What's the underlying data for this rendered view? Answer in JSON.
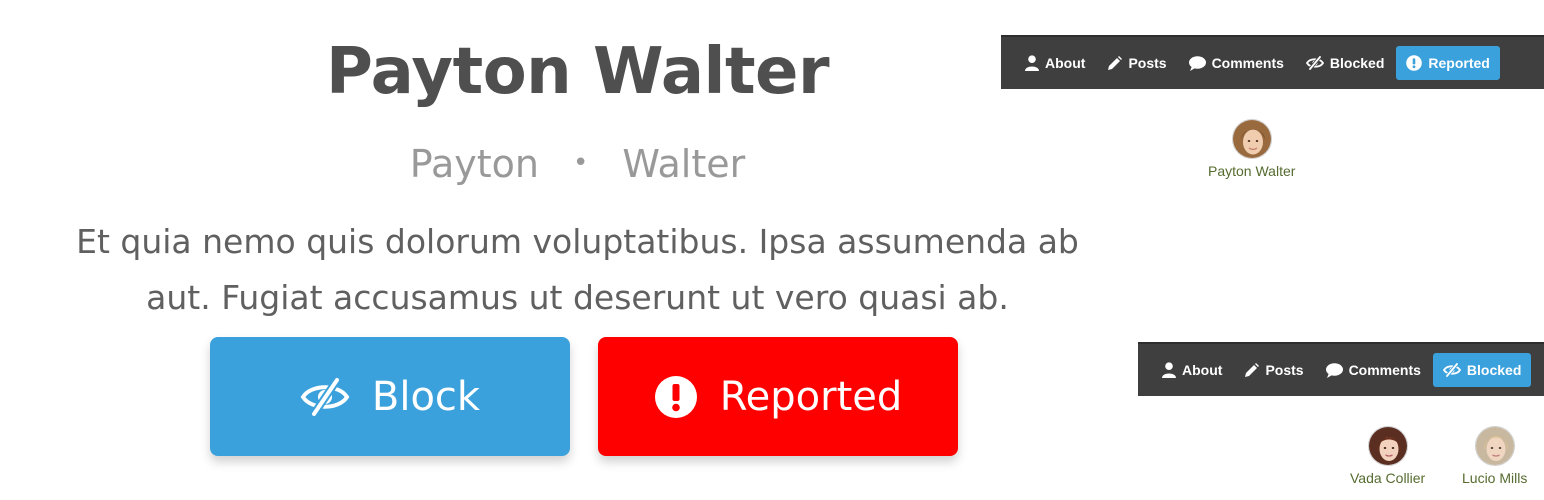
{
  "profile": {
    "full_name": "Payton Walter",
    "first_name": "Payton",
    "separator": "•",
    "last_name": "Walter",
    "bio": "Et quia nemo quis dolorum voluptatibus. Ipsa assumenda ab aut. Fugiat accusamus ut deserunt ut vero quasi ab.",
    "block_label": "Block",
    "reported_label": "Reported"
  },
  "colors": {
    "accent": "#3ba1dc",
    "danger": "#ff0000",
    "nav_bg": "#3f3f3f",
    "user_link": "#556b2f"
  },
  "nav_top": {
    "items": [
      {
        "label": "About",
        "icon": "user-icon"
      },
      {
        "label": "Posts",
        "icon": "pencil-icon"
      },
      {
        "label": "Comments",
        "icon": "comment-icon"
      },
      {
        "label": "Blocked",
        "icon": "eye-slash-icon"
      },
      {
        "label": "Reported",
        "icon": "exclamation-circle-icon",
        "active": true
      }
    ],
    "users": [
      {
        "name": "Payton Walter"
      }
    ]
  },
  "nav_bottom": {
    "items": [
      {
        "label": "About",
        "icon": "user-icon"
      },
      {
        "label": "Posts",
        "icon": "pencil-icon"
      },
      {
        "label": "Comments",
        "icon": "comment-icon"
      },
      {
        "label": "Blocked",
        "icon": "eye-slash-icon",
        "active": true
      }
    ],
    "users": [
      {
        "name": "Vada Collier"
      },
      {
        "name": "Lucio Mills"
      }
    ]
  }
}
